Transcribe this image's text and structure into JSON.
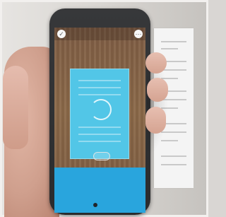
{
  "screen": {
    "hint": "",
    "icons": {
      "left_top": "check-icon",
      "right_top": "menu-icon",
      "capture": "capture-ring-icon"
    }
  },
  "colors": {
    "document_highlight": "#52c6e7",
    "bottom_panel": "#29a5dd",
    "phone_body": "#2f3032"
  }
}
